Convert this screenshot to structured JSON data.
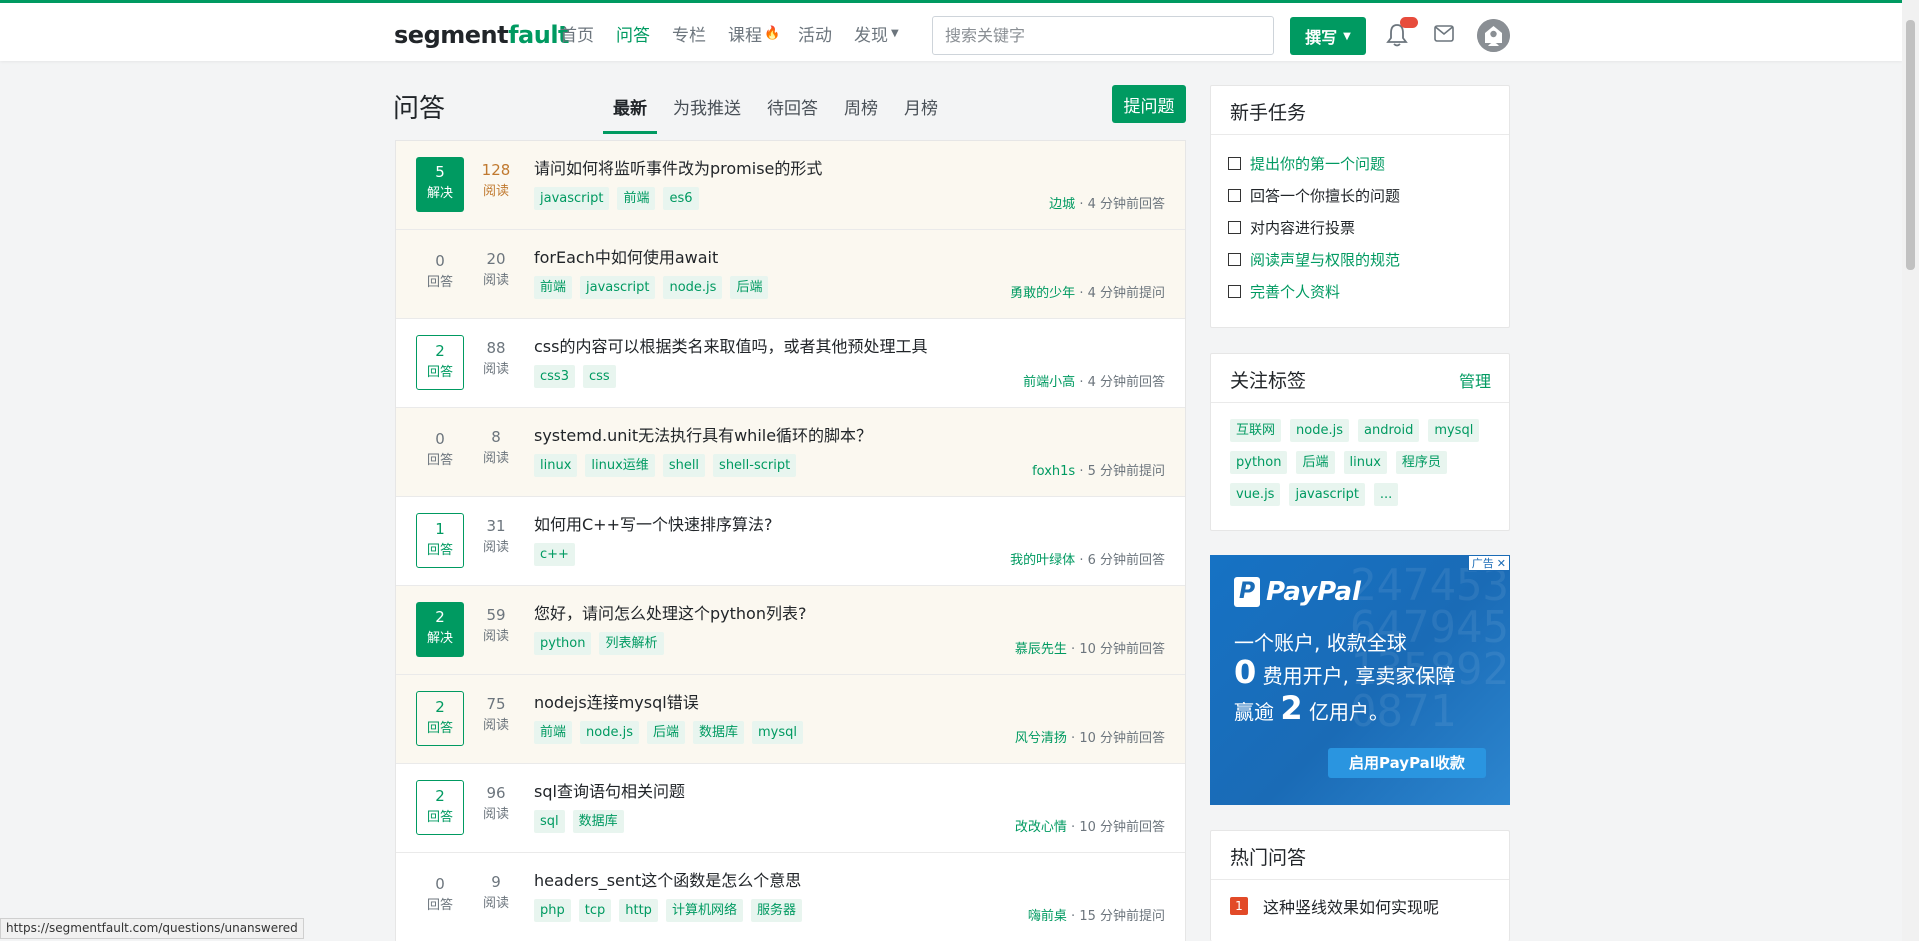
{
  "header": {
    "logo_a": "segment",
    "logo_b": "fault",
    "nav": [
      {
        "label": "首页"
      },
      {
        "label": "问答"
      },
      {
        "label": "专栏"
      },
      {
        "label": "课程"
      },
      {
        "label": "活动"
      },
      {
        "label": "发现"
      }
    ],
    "search_placeholder": "搜索关键字",
    "write_label": "撰写"
  },
  "main": {
    "title": "问答",
    "tabs": [
      "最新",
      "为我推送",
      "待回答",
      "周榜",
      "月榜"
    ],
    "ask_button": "提问题",
    "questions": [
      {
        "answers": "5",
        "answers_label": "解决",
        "views": "128",
        "views_label": "阅读",
        "title": "请问如何将监听事件改为promise的形式",
        "tags": [
          "javascript",
          "前端",
          "es6"
        ],
        "author": "边城",
        "meta": " · 4 分钟前回答"
      },
      {
        "answers": "0",
        "answers_label": "回答",
        "views": "20",
        "views_label": "阅读",
        "title": "forEach中如何使用await",
        "tags": [
          "前端",
          "javascript",
          "node.js",
          "后端"
        ],
        "author": "勇敢的少年",
        "meta": " · 4 分钟前提问"
      },
      {
        "answers": "2",
        "answers_label": "回答",
        "views": "88",
        "views_label": "阅读",
        "title": "css的内容可以根据类名来取值吗，或者其他预处理工具",
        "tags": [
          "css3",
          "css"
        ],
        "author": "前端小高",
        "meta": " · 4 分钟前回答"
      },
      {
        "answers": "0",
        "answers_label": "回答",
        "views": "8",
        "views_label": "阅读",
        "title": "systemd.unit无法执行具有while循环的脚本？",
        "tags": [
          "linux",
          "linux运维",
          "shell",
          "shell-script"
        ],
        "author": "foxh1s",
        "meta": " · 5 分钟前提问"
      },
      {
        "answers": "1",
        "answers_label": "回答",
        "views": "31",
        "views_label": "阅读",
        "title": "如何用C++写一个快速排序算法?",
        "tags": [
          "c++"
        ],
        "author": "我的叶绿体",
        "meta": " · 6 分钟前回答"
      },
      {
        "answers": "2",
        "answers_label": "解决",
        "views": "59",
        "views_label": "阅读",
        "title": "您好，请问怎么处理这个python列表?",
        "tags": [
          "python",
          "列表解析"
        ],
        "author": "慕辰先生",
        "meta": " · 10 分钟前回答"
      },
      {
        "answers": "2",
        "answers_label": "回答",
        "views": "75",
        "views_label": "阅读",
        "title": "nodejs连接mysql错误",
        "tags": [
          "前端",
          "node.js",
          "后端",
          "数据库",
          "mysql"
        ],
        "author": "风兮清扬",
        "meta": " · 10 分钟前回答"
      },
      {
        "answers": "2",
        "answers_label": "回答",
        "views": "96",
        "views_label": "阅读",
        "title": "sql查询语句相关问题",
        "tags": [
          "sql",
          "数据库"
        ],
        "author": "改改心情",
        "meta": " · 10 分钟前回答"
      },
      {
        "answers": "0",
        "answers_label": "回答",
        "views": "9",
        "views_label": "阅读",
        "title": "headers_sent这个函数是怎么个意思",
        "tags": [
          "php",
          "tcp",
          "http",
          "计算机网络",
          "服务器"
        ],
        "author": "嗨前桌",
        "meta": " · 15 分钟前提问"
      }
    ]
  },
  "sidebar": {
    "tasks_title": "新手任务",
    "tasks": [
      "提出你的第一个问题",
      "回答一个你擅长的问题",
      "对内容进行投票",
      "阅读声望与权限的规范",
      "完善个人资料"
    ],
    "follow_title": "关注标签",
    "manage_label": "管理",
    "follow_tags": [
      "互联网",
      "node.js",
      "android",
      "mysql",
      "python",
      "后端",
      "linux",
      "程序员",
      "vue.js",
      "javascript",
      "..."
    ],
    "ad": {
      "brand": "PayPal",
      "line1": "一个账户, 收款全球",
      "line2_num": "0",
      "line2_text": " 费用开户, 享卖家保障",
      "line3_pre": "赢逾 ",
      "line3_num": "2",
      "line3_text": " 亿用户。",
      "cta": "启用PayPal收款",
      "badge": "广告",
      "close": "✕"
    },
    "hot_title": "热门问答",
    "hot": [
      {
        "rank": "1",
        "title": "这种竖线效果如何实现呢"
      }
    ]
  },
  "status_url": "https://segmentfault.com/questions/unanswered"
}
